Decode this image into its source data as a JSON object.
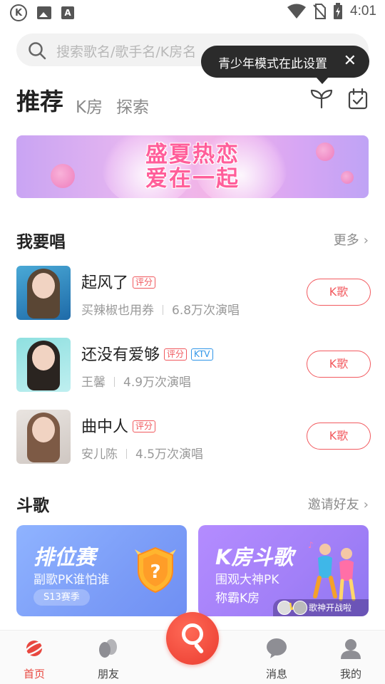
{
  "status_bar": {
    "time": "4:01",
    "app_badge": "K",
    "a_badge": "A"
  },
  "search": {
    "placeholder": "搜索歌名/歌手名/K房名"
  },
  "tooltip": {
    "text": "青少年模式在此设置",
    "close": "✕"
  },
  "tabs": [
    {
      "label": "推荐",
      "active": true
    },
    {
      "label": "K房",
      "active": false
    },
    {
      "label": "探索",
      "active": false
    }
  ],
  "banner": {
    "line1": "盛夏热恋",
    "line2": "爱在一起"
  },
  "sing_section": {
    "title": "我要唱",
    "more": "更多",
    "songs": [
      {
        "title": "起风了",
        "tags": [
          "评分"
        ],
        "artist": "买辣椒也用券",
        "plays": "6.8万次演唱",
        "button": "K歌"
      },
      {
        "title": "还没有爱够",
        "tags": [
          "评分",
          "KTV"
        ],
        "artist": "王馨",
        "plays": "4.9万次演唱",
        "button": "K歌"
      },
      {
        "title": "曲中人",
        "tags": [
          "评分"
        ],
        "artist": "安儿陈",
        "plays": "4.5万次演唱",
        "button": "K歌"
      }
    ]
  },
  "battle_section": {
    "title": "斗歌",
    "invite": "邀请好友",
    "cards": [
      {
        "title": "排位赛",
        "subtitle": "副歌PK谁怕谁",
        "season": "S13赛季"
      },
      {
        "title": "K房斗歌",
        "subtitle": "围观大神PK",
        "subtitle2": "称霸K房",
        "vs_label": "VS",
        "vs_text": "歌神开战啦"
      }
    ]
  },
  "bottom_nav": [
    {
      "label": "首页",
      "icon": "planet-icon",
      "active": true
    },
    {
      "label": "朋友",
      "icon": "friends-icon",
      "active": false
    },
    {
      "label": "消息",
      "icon": "chat-bubble-icon",
      "active": false
    },
    {
      "label": "我的",
      "icon": "profile-icon",
      "active": false
    }
  ],
  "colors": {
    "accent": "#f25a5f",
    "nav_active": "#e8473f",
    "ktv_tag": "#2f95e8",
    "tooltip_bg": "#2b2b2b"
  }
}
